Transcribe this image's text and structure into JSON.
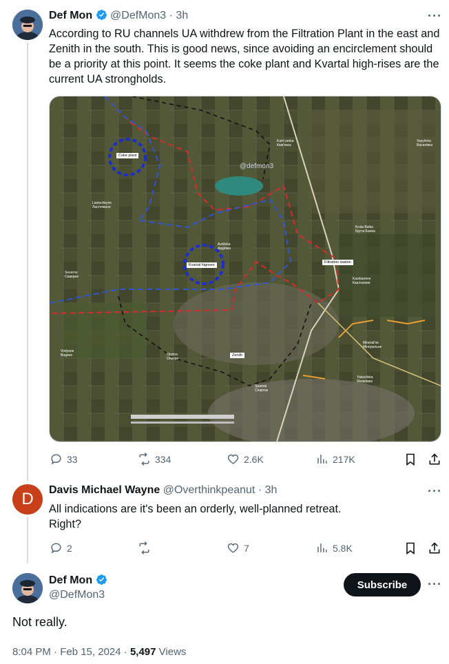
{
  "tweet1": {
    "name": "Def Mon",
    "handle": "@DefMon3",
    "time": "3h",
    "text": "According to RU channels UA withdrew from the Filtration Plant in the east and Zenith in the south. This is good news, since avoiding an encirclement should be a priority at this point. It seems the coke plant and Kvartal high-rises are the current UA strongholds.",
    "stats": {
      "replies": "33",
      "reposts": "334",
      "likes": "2.6K",
      "views": "217K"
    },
    "map": {
      "watermark": "@defmon3",
      "labels": {
        "coke": "Coke plant",
        "kvartal": "Kvartal higrises",
        "filtration": "Filtration station",
        "zenith": "Zenith",
        "kamyanka": "Kam'yanka\nКам'янка",
        "vasylivka": "Vasylivka\nВасилівка",
        "lastochkyne": "Lastochkyne\nЛасточкине",
        "avdiivka": "Avdiivka\nАвдіївка",
        "kruta": "Kruta Balka\nКрута Балка",
        "severne": "Severne\nСеверне",
        "kashtanove": "Kashtanove\nКаштанове",
        "mineralne": "Mineral'ne\nМінеральне",
        "vodyane": "Vodyane\nВодяне",
        "opytne": "Opytne\nОпитне",
        "spartak": "Spartak\nСпартак",
        "yakovlivka": "Yakovlivka\nЯковлівка"
      }
    }
  },
  "tweet2": {
    "initial": "D",
    "name": "Davis Michael Wayne",
    "handle": "@Overthinkpeanut",
    "time": "3h",
    "line1": "All indications are it's been an orderly, well-planned retreat.",
    "line2": "Right?",
    "stats": {
      "replies": "2",
      "reposts": "",
      "likes": "7",
      "views": "5.8K"
    }
  },
  "tweet3": {
    "name": "Def Mon",
    "handle": "@DefMon3",
    "subscribe": "Subscribe",
    "text": "Not really.",
    "time": "8:04 PM · Feb 15, 2024 · ",
    "views_count": "5,497",
    "views_label": "Views"
  },
  "colors": {
    "verified": "#1d9bf0",
    "text": "#0f1419",
    "muted": "#536471"
  }
}
